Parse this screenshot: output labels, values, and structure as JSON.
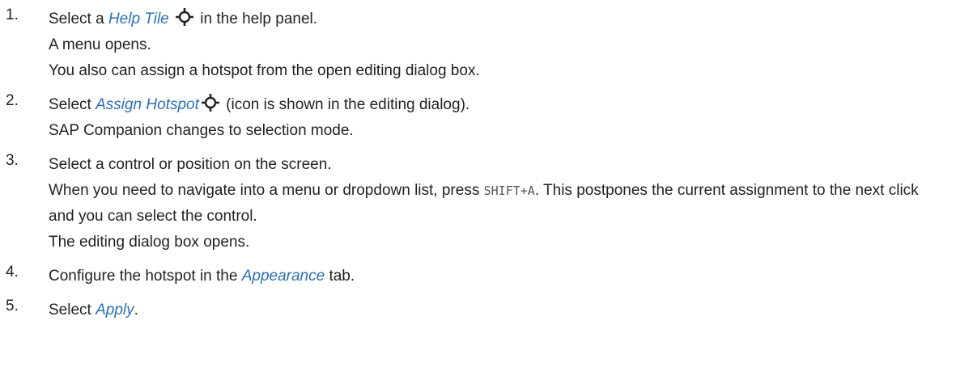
{
  "steps": [
    {
      "number": "1.",
      "pre": "Select a ",
      "ui": "Help Tile",
      "icon": "crosshair-icon",
      "post": " in the help panel.",
      "result1": "A menu opens.",
      "result2": "You also can assign a hotspot from the open editing dialog box."
    },
    {
      "number": "2.",
      "pre": "Select ",
      "ui": "Assign Hotspot",
      "icon": "crosshair-icon",
      "post": " (icon is shown in the editing dialog).",
      "result1": "SAP Companion changes to selection mode."
    },
    {
      "number": "3.",
      "text": "Select a control or position on the screen.",
      "note_pre": "When you need to navigate into a menu or dropdown list, press ",
      "note_code": "SHIFT+A",
      "note_post": ". This postpones the current assignment to the next click and you can select the control.",
      "result1": "The editing dialog box opens."
    },
    {
      "number": "4.",
      "pre": "Configure the hotspot in the ",
      "ui": "Appearance",
      "post": " tab."
    },
    {
      "number": "5.",
      "pre": "Select ",
      "ui": "Apply",
      "post": "."
    }
  ],
  "colors": {
    "ui_text": "#2d6fb6",
    "body_text": "#222222",
    "icon": "#222222"
  }
}
